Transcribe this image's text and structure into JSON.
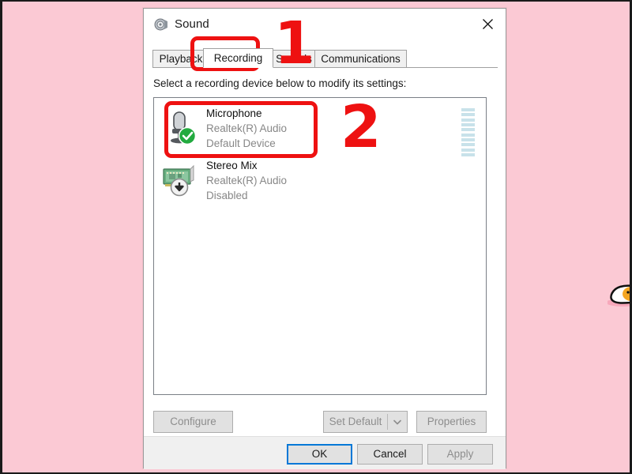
{
  "window": {
    "title": "Sound",
    "icon": "speaker-icon",
    "close_label": "✕"
  },
  "tabs": [
    {
      "label": "Playback",
      "active": false
    },
    {
      "label": "Recording",
      "active": true
    },
    {
      "label": "Sounds",
      "active": false
    },
    {
      "label": "Communications",
      "active": false
    }
  ],
  "instruction": "Select a recording device below to modify its settings:",
  "devices": [
    {
      "name": "Microphone",
      "driver": "Realtek(R) Audio",
      "status": "Default Device",
      "icon": "microphone-icon",
      "badge": "check-badge-icon",
      "selected": true,
      "meter_segments": 10
    },
    {
      "name": "Stereo Mix",
      "driver": "Realtek(R) Audio",
      "status": "Disabled",
      "icon": "sound-card-icon",
      "badge": "down-arrow-badge-icon",
      "selected": false,
      "meter_segments": 0
    }
  ],
  "mid_buttons": {
    "configure": "Configure",
    "set_default": "Set Default",
    "set_default_arrow": "chevron-down-icon",
    "properties": "Properties"
  },
  "footer_buttons": {
    "ok": "OK",
    "cancel": "Cancel",
    "apply": "Apply"
  },
  "annotations": [
    {
      "number": "1",
      "target": "recording-tab"
    },
    {
      "number": "2",
      "target": "microphone-device-row"
    }
  ],
  "colors": {
    "page_background": "#fbc9d4",
    "annotation_red": "#ee1111",
    "focus_blue": "#0078d7",
    "meter_segment": "#c8e2ea",
    "default_badge_green": "#22aa3f"
  }
}
